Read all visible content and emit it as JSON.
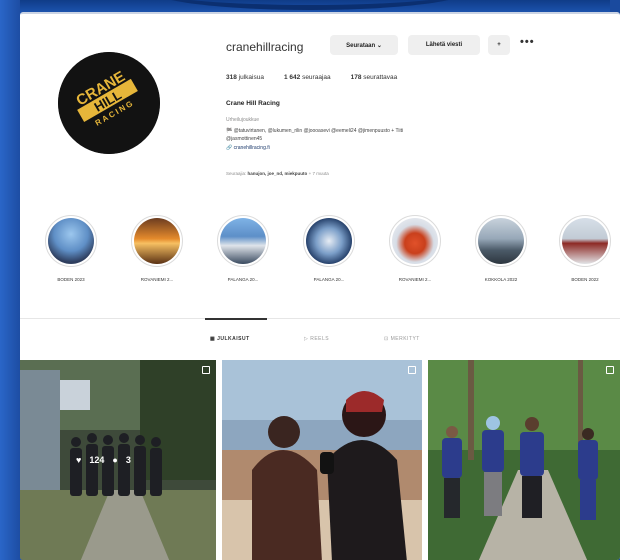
{
  "profile": {
    "username": "cranehillracing",
    "follow_label": "Seurataan ⌄",
    "message_label": "Lähetä viesti",
    "add_label": "+",
    "more_label": "•••",
    "posts_count": "318",
    "posts_label": "julkaisua",
    "followers_count": "1 642",
    "followers_label": "seuraajaa",
    "following_count": "178",
    "following_label": "seurattavaa",
    "full_name": "Crane Hill Racing",
    "category": "Urheilujoukkue",
    "bio_line1": "🏁 @tatuvirtanen, @lukumen_rilin @joooasevi @eemeli24 @jimenpuusto + Tiiti",
    "bio_line2": "@jasmottinen45",
    "link": "🔗 cranehillracing.fi",
    "followed_by_prefix": "Seuraajia:",
    "followed_by_names": "hanujon, joe_nd, miekpuuto",
    "followed_by_suffix": "+ 7 muuta",
    "logo_line1": "CRANE",
    "logo_line2": "HILL",
    "logo_line3": "RACING"
  },
  "highlights": [
    {
      "label": "BODEN 2023"
    },
    {
      "label": "ROVANIEMI 2..."
    },
    {
      "label": "PALANGA 20..."
    },
    {
      "label": "PALANGA 20..."
    },
    {
      "label": "ROVANIEMI 2..."
    },
    {
      "label": "KOKKOLA 2022"
    },
    {
      "label": "BODEN 2022"
    }
  ],
  "tabs": {
    "posts": "▦ JULKAISUT",
    "reels": "▷ REELS",
    "tagged": "⊡ MERKITYT"
  },
  "post_overlay": {
    "likes": "124",
    "comments": "3"
  },
  "colors": {
    "background_blue": "#1f57b4",
    "logo_yellow": "#e6b63a",
    "follow_button_bg": "#efefef"
  }
}
